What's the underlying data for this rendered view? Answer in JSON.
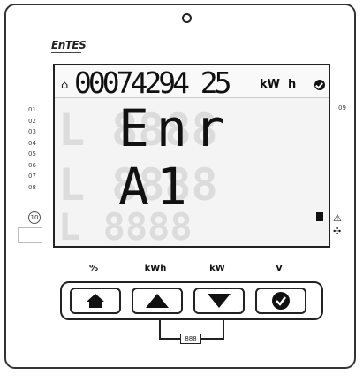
{
  "brand": "EnTES",
  "display": {
    "counter_value": "00074294 25",
    "counter_unit_1": "kW",
    "counter_unit_2": "h",
    "main_line_1": "Enr",
    "main_line_2": "A1",
    "side_labels": [
      "01",
      "02",
      "03",
      "04",
      "05",
      "06",
      "07",
      "08"
    ],
    "side_right_label": "09",
    "circle_label": "10"
  },
  "buttons": [
    {
      "label": "%",
      "icon": "home-icon"
    },
    {
      "label": "kWh",
      "icon": "up-arrow-icon"
    },
    {
      "label": "kW",
      "icon": "down-arrow-icon"
    },
    {
      "label": "V",
      "icon": "check-circle-icon"
    }
  ],
  "connector_label": "888"
}
